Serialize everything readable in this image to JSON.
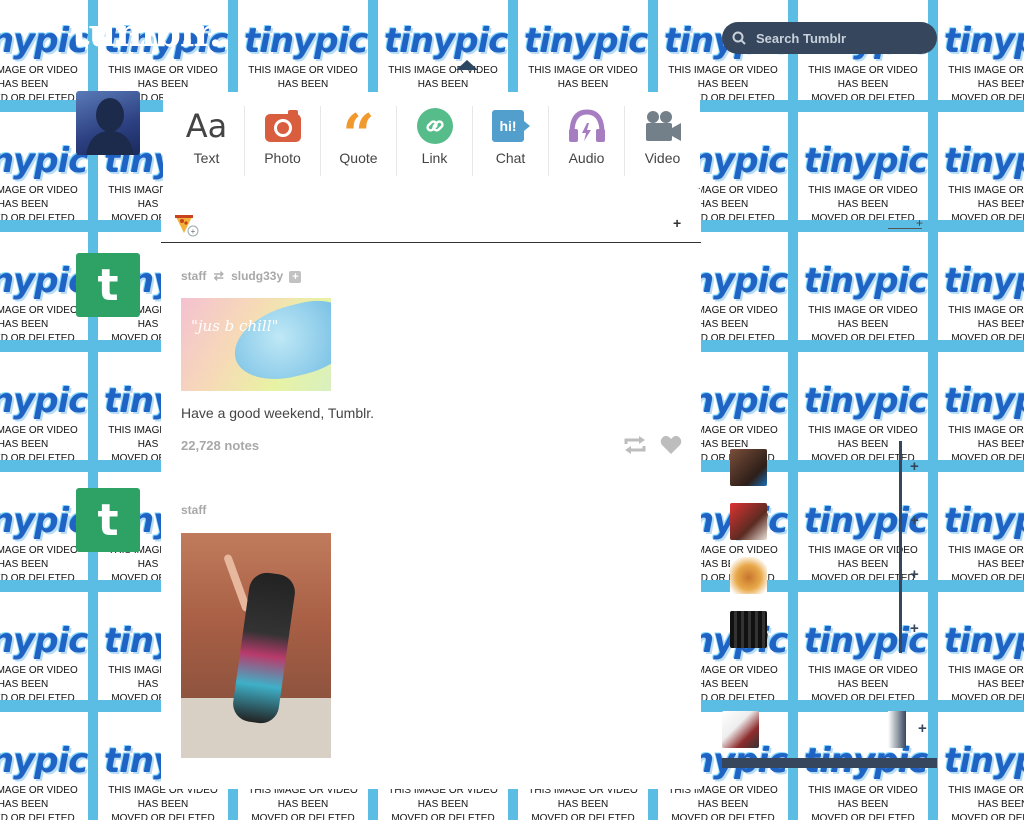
{
  "app": {
    "brand": "tumblr.",
    "search_placeholder": "Search Tumblr"
  },
  "background": {
    "logo_text": "tinypic",
    "message_lines": [
      "THIS IMAGE OR VIDEO",
      "HAS BEEN",
      "MOVED OR DELETED"
    ],
    "top_partial_line": "MOVED OR DELETED"
  },
  "post_types": [
    {
      "label": "Text",
      "icon": "text-icon",
      "color": "#444444"
    },
    {
      "label": "Photo",
      "icon": "camera-icon",
      "color": "#d95e40"
    },
    {
      "label": "Quote",
      "icon": "quote-icon",
      "color": "#f2992e"
    },
    {
      "label": "Link",
      "icon": "link-icon",
      "color": "#56bc8a"
    },
    {
      "label": "Chat",
      "icon": "chat-icon",
      "color": "#529ecc"
    },
    {
      "label": "Audio",
      "icon": "headphones-icon",
      "color": "#a77dc2"
    },
    {
      "label": "Video",
      "icon": "video-camera-icon",
      "color": "#748089"
    }
  ],
  "posts": [
    {
      "author": "staff",
      "reblogged_from": "sludg33y",
      "image_caption_overlay": "\"jus b chill\"",
      "body": "Have a good weekend, Tumblr.",
      "notes": "22,728 notes"
    },
    {
      "author": "staff"
    }
  ],
  "colors": {
    "accent": "#36465d",
    "bg_tile_border": "#5bbde4",
    "tumblr_green": "#2ea264"
  }
}
